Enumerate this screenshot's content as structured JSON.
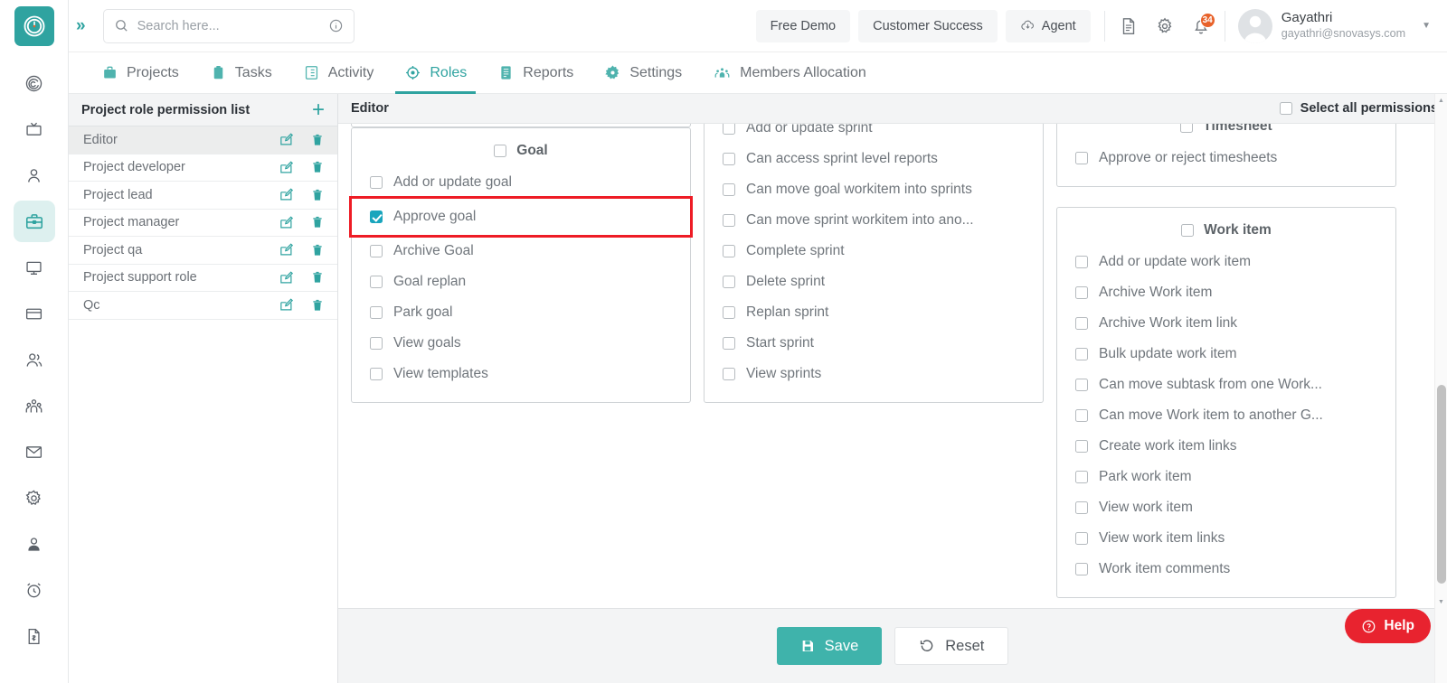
{
  "brand": {
    "accent": "#2fa3a0",
    "checked_color": "#19a5bd",
    "highlight_color": "#ee1c25",
    "help_color": "#e8232f"
  },
  "header": {
    "search_placeholder": "Search here...",
    "expand_label": "»",
    "buttons": [
      {
        "label": "Free Demo",
        "name": "free-demo-button",
        "icon": null
      },
      {
        "label": "Customer Success",
        "name": "customer-success-button",
        "icon": null
      },
      {
        "label": "Agent",
        "name": "agent-button",
        "icon": "cloud-download-icon"
      }
    ],
    "notification_count": "34",
    "user": {
      "name": "Gayathri",
      "email": "gayathri@snovasys.com"
    }
  },
  "nav": {
    "tabs": [
      {
        "label": "Projects",
        "icon": "briefcase-icon",
        "active": false
      },
      {
        "label": "Tasks",
        "icon": "clipboard-icon",
        "active": false
      },
      {
        "label": "Activity",
        "icon": "list-icon",
        "active": false
      },
      {
        "label": "Roles",
        "icon": "target-icon",
        "active": true
      },
      {
        "label": "Reports",
        "icon": "report-icon",
        "active": false
      },
      {
        "label": "Settings",
        "icon": "gear-icon",
        "active": false
      },
      {
        "label": "Members Allocation",
        "icon": "members-icon",
        "active": false
      }
    ]
  },
  "rail": {
    "icons": [
      {
        "name": "spiral-icon",
        "active": false
      },
      {
        "name": "tv-icon",
        "active": false
      },
      {
        "name": "user-icon",
        "active": false
      },
      {
        "name": "briefcase-icon",
        "active": true
      },
      {
        "name": "monitor-icon",
        "active": false
      },
      {
        "name": "card-icon",
        "active": false
      },
      {
        "name": "users-icon",
        "active": false
      },
      {
        "name": "team-icon",
        "active": false
      },
      {
        "name": "mail-icon",
        "active": false
      },
      {
        "name": "gear-icon",
        "active": false
      },
      {
        "name": "profile-icon",
        "active": false
      },
      {
        "name": "alarm-icon",
        "active": false
      },
      {
        "name": "invoice-icon",
        "active": false
      }
    ]
  },
  "role_list": {
    "title": "Project role permission list",
    "add_label": "+",
    "roles": [
      {
        "name": "Editor",
        "selected": true
      },
      {
        "name": "Project developer",
        "selected": false
      },
      {
        "name": "Project lead",
        "selected": false
      },
      {
        "name": "Project manager",
        "selected": false
      },
      {
        "name": "Project qa",
        "selected": false
      },
      {
        "name": "Project support role",
        "selected": false
      },
      {
        "name": "Qc",
        "selected": false
      }
    ]
  },
  "main": {
    "title": "Editor",
    "select_all_label": "Select all permissions",
    "select_all_checked": false,
    "columns": [
      {
        "name": "column-1",
        "partial_top_panel": true,
        "panels": [
          {
            "title": "Goal",
            "title_checked": false,
            "options": [
              {
                "label": "Add or update goal",
                "checked": false,
                "highlighted": false
              },
              {
                "label": "Approve goal",
                "checked": true,
                "highlighted": true
              },
              {
                "label": "Archive Goal",
                "checked": false,
                "highlighted": false
              },
              {
                "label": "Goal replan",
                "checked": false,
                "highlighted": false
              },
              {
                "label": "Park goal",
                "checked": false,
                "highlighted": false
              },
              {
                "label": "View goals",
                "checked": false,
                "highlighted": false
              },
              {
                "label": "View templates",
                "checked": false,
                "highlighted": false
              }
            ]
          }
        ]
      },
      {
        "name": "column-2",
        "partial_top_panel": false,
        "panels": [
          {
            "title": null,
            "title_checked": false,
            "cut_top": true,
            "options": [
              {
                "label": "Add or update sprint",
                "checked": false,
                "highlighted": false
              },
              {
                "label": "Can access sprint level reports",
                "checked": false,
                "highlighted": false
              },
              {
                "label": "Can move goal workitem into sprints",
                "checked": false,
                "highlighted": false
              },
              {
                "label": "Can move sprint workitem into ano...",
                "checked": false,
                "highlighted": false
              },
              {
                "label": "Complete sprint",
                "checked": false,
                "highlighted": false
              },
              {
                "label": "Delete sprint",
                "checked": false,
                "highlighted": false
              },
              {
                "label": "Replan sprint",
                "checked": false,
                "highlighted": false
              },
              {
                "label": "Start sprint",
                "checked": false,
                "highlighted": false
              },
              {
                "label": "View sprints",
                "checked": false,
                "highlighted": false
              }
            ]
          }
        ]
      },
      {
        "name": "column-3",
        "partial_top_panel": false,
        "panels": [
          {
            "title": "Timesheet",
            "title_checked": false,
            "cut_top": true,
            "options": [
              {
                "label": "Approve or reject timesheets",
                "checked": false,
                "highlighted": false
              }
            ]
          },
          {
            "title": "Work item",
            "title_checked": false,
            "options": [
              {
                "label": "Add or update work item",
                "checked": false,
                "highlighted": false
              },
              {
                "label": "Archive Work item",
                "checked": false,
                "highlighted": false
              },
              {
                "label": "Archive Work item link",
                "checked": false,
                "highlighted": false
              },
              {
                "label": "Bulk update work item",
                "checked": false,
                "highlighted": false
              },
              {
                "label": "Can move subtask from one Work...",
                "checked": false,
                "highlighted": false
              },
              {
                "label": "Can move Work item to another G...",
                "checked": false,
                "highlighted": false
              },
              {
                "label": "Create work item links",
                "checked": false,
                "highlighted": false
              },
              {
                "label": "Park work item",
                "checked": false,
                "highlighted": false
              },
              {
                "label": "View work item",
                "checked": false,
                "highlighted": false
              },
              {
                "label": "View work item links",
                "checked": false,
                "highlighted": false
              },
              {
                "label": "Work item comments",
                "checked": false,
                "highlighted": false
              }
            ]
          }
        ]
      }
    ]
  },
  "footer": {
    "save_label": "Save",
    "reset_label": "Reset"
  },
  "help": {
    "label": "Help"
  }
}
